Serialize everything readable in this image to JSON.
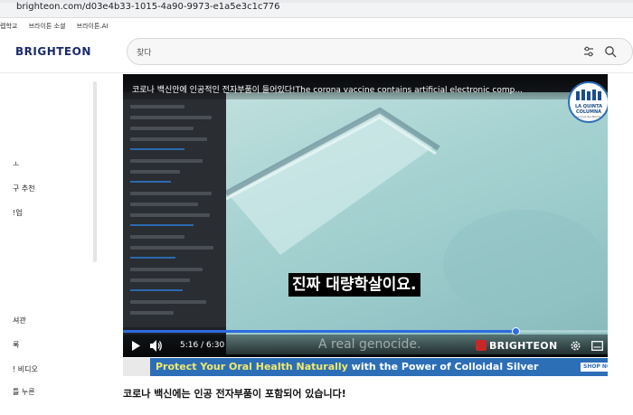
{
  "browser": {
    "url": "brighteon.com/d03e4b33-1015-4a90-9973-e1a5e3c1c776"
  },
  "topnav": {
    "items": [
      "렙학교",
      "브라이튼 소셜",
      "브라이튼.AI"
    ]
  },
  "logo": "BRIGHTEON",
  "search": {
    "placeholder": "찾다"
  },
  "sidebar": {
    "items": [
      "ㅗ",
      "구 추천",
      "!업",
      "셔관",
      "록",
      "! 비디오",
      "틀 누른"
    ]
  },
  "player": {
    "title": "코로나 백신안에 인공적인 전자부품이 들어있다!The corona vaccine contains artificial electronic comp...",
    "channel_badge": {
      "line1": "LA QUINTA",
      "line2": "COLUMNA",
      "line3": "La Cruz del Mundo"
    },
    "subtitle": "진짜 대량학살이요.",
    "watermark_subtitle": "A real genocide.",
    "current_time": "5:16",
    "duration": "6:30",
    "progress": 0.81,
    "brand": "BRIGHTEON",
    "accent_color": "#2d6be0"
  },
  "ad_banner": {
    "text_highlight": "Protect Your Oral Health Naturally",
    "text_rest": " with the Power of Colloidal Silver",
    "cta": "SHOP NO",
    "bg_color": "#2c6fb7"
  },
  "video_title": "코로나 백신에는 인공 전자부품이 포함되어 있습니다!"
}
